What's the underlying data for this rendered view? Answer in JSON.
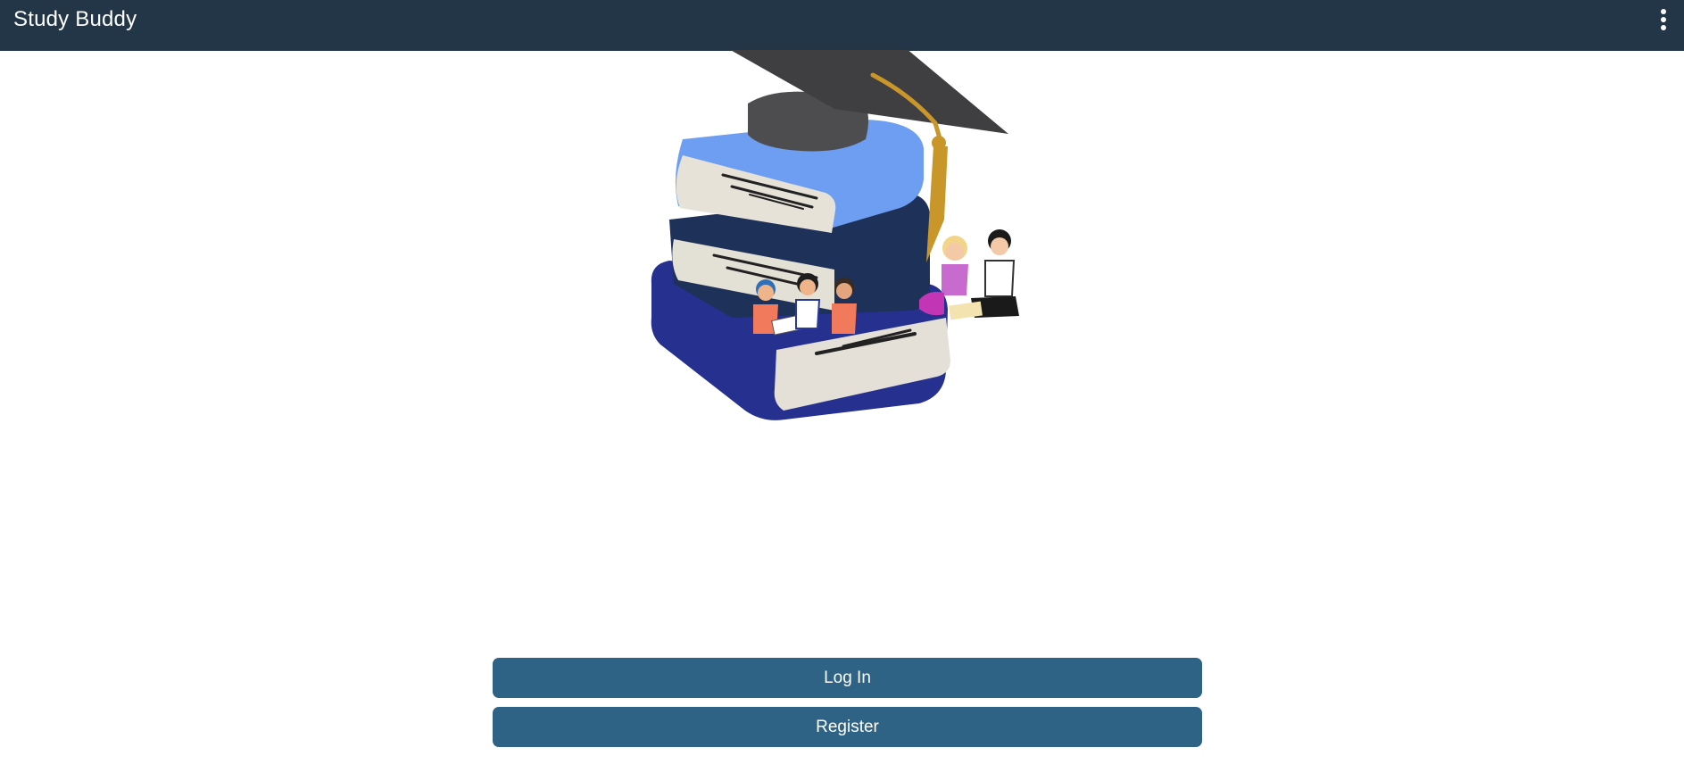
{
  "app_bar": {
    "title": "Study Buddy",
    "menu_icon": "more-vert-icon"
  },
  "hero": {
    "illustration": "books-graduation-cap-kids-illustration"
  },
  "actions": {
    "login_label": "Log In",
    "register_label": "Register"
  },
  "colors": {
    "app_bar": "#233648",
    "button": "#2e6385",
    "button_text": "#ffffff",
    "background": "#ffffff"
  }
}
